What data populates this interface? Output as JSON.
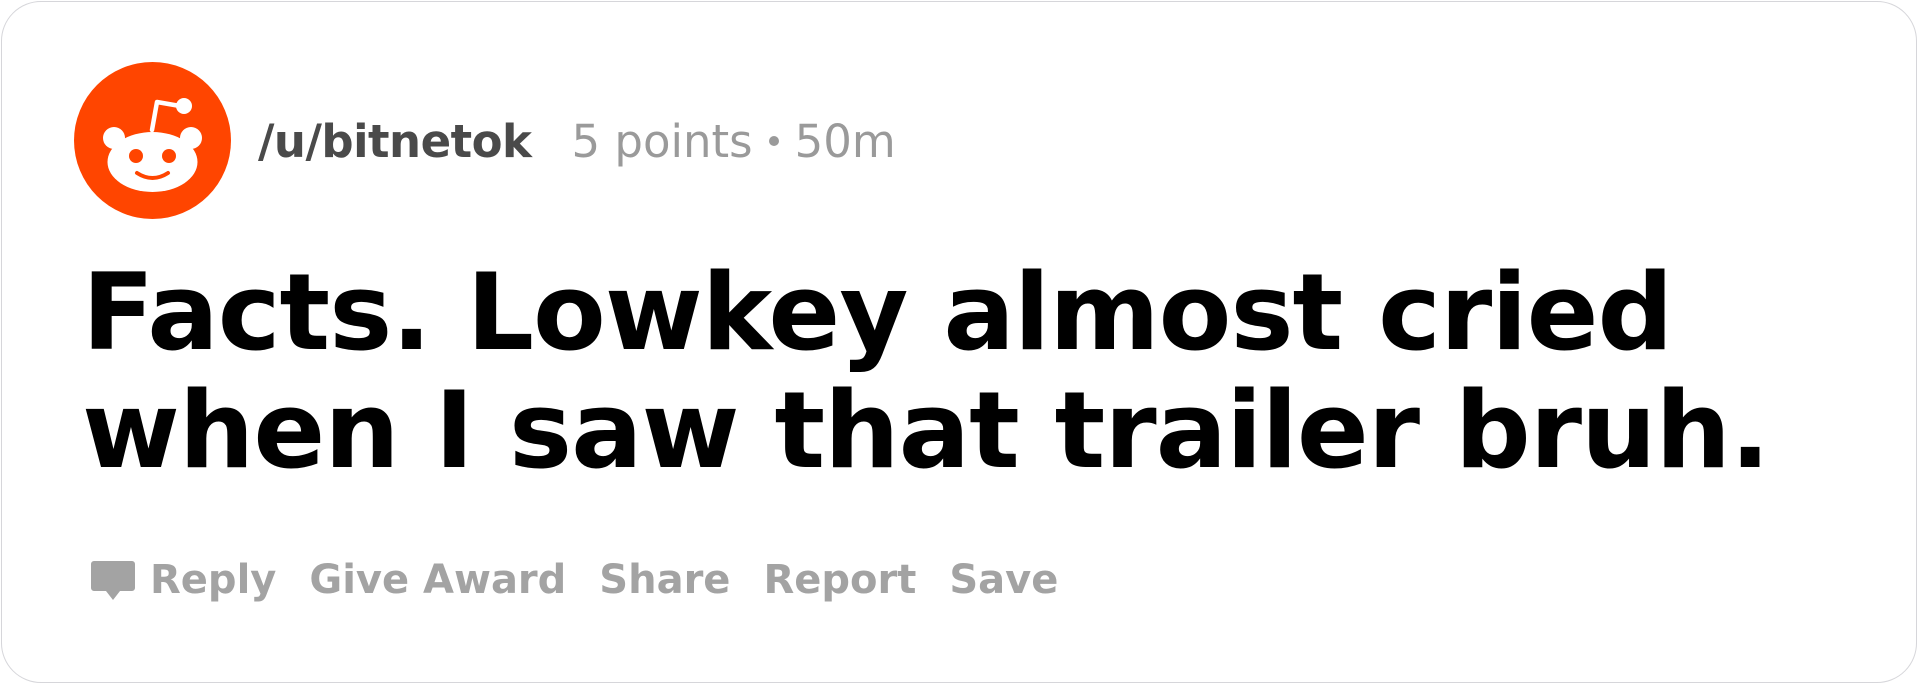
{
  "comment": {
    "username": "/u/bitnetok",
    "points": "5 points",
    "age": "50m",
    "text_line1": "Facts. Lowkey almost cried",
    "text_line2": "when I saw that trailer bruh."
  },
  "actions": {
    "reply": "Reply",
    "give_award": "Give Award",
    "share": "Share",
    "report": "Report",
    "save": "Save"
  },
  "icons": {
    "avatar": "reddit-snoo-icon",
    "reply": "comment-bubble-icon"
  },
  "colors": {
    "brand": "#ff4500",
    "username": "#4a4a4a",
    "meta": "#9a9a9a",
    "actions": "#a3a3a3",
    "text": "#000000"
  }
}
